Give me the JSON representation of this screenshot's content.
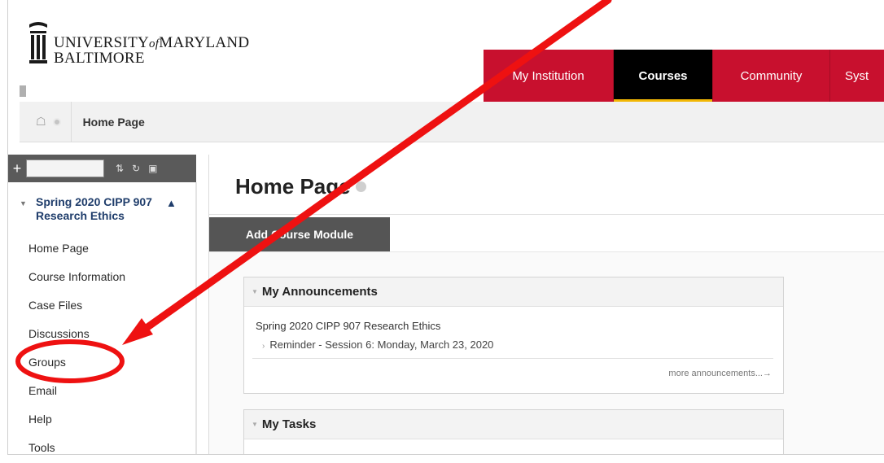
{
  "logo": {
    "line1_a": "UNIVERSITY",
    "line1_of": "of",
    "line1_b": "MARYLAND",
    "line2": "BALTIMORE"
  },
  "tabs": [
    {
      "label": "My Institution"
    },
    {
      "label": "Courses"
    },
    {
      "label": "Community"
    },
    {
      "label": "Syst"
    }
  ],
  "breadcrumb": {
    "home_icon": "home-icon",
    "current": "Home Page"
  },
  "leftnav": {
    "course_title": "Spring 2020 CIPP 907 Research Ethics",
    "items": [
      {
        "label": "Home Page"
      },
      {
        "label": "Course Information"
      },
      {
        "label": "Case Files"
      },
      {
        "label": "Discussions"
      },
      {
        "label": "Groups"
      },
      {
        "label": "Email"
      },
      {
        "label": "Help"
      },
      {
        "label": "Tools"
      }
    ]
  },
  "main": {
    "page_title": "Home Page",
    "add_module_label": "Add Course Module",
    "announcements": {
      "title": "My Announcements",
      "course": "Spring 2020 CIPP 907 Research Ethics",
      "item": "Reminder - Session 6: Monday, March 23, 2020",
      "more": "more announcements...→"
    },
    "tasks": {
      "title": "My Tasks"
    }
  },
  "colors": {
    "brand_red": "#c8102e",
    "active_tab": "#000000",
    "active_underline": "#f2b705",
    "annotation_red": "#ee1111"
  }
}
